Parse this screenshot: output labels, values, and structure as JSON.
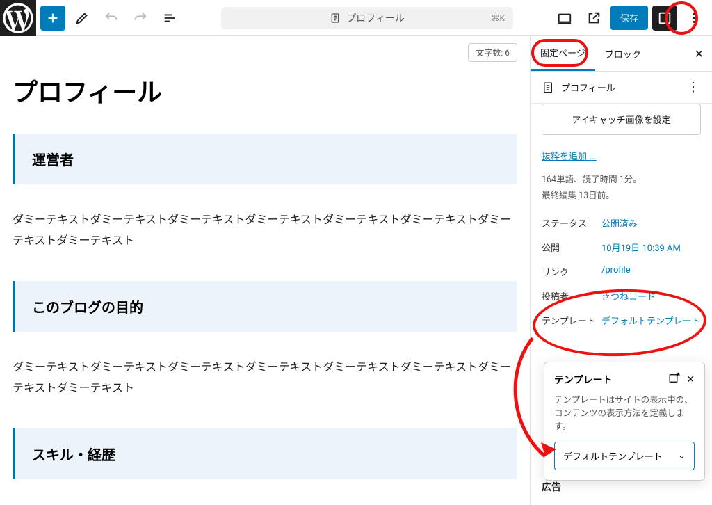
{
  "header": {
    "doc_title": "プロフィール",
    "kbd": "⌘K",
    "save_label": "保存"
  },
  "editor": {
    "wordcount_label": "文字数: 6",
    "title": "プロフィール",
    "h1": "運営者",
    "p1": "ダミーテキストダミーテキストダミーテキストダミーテキストダミーテキストダミーテキストダミーテキストダミーテキスト",
    "h2": "このブログの目的",
    "p2": "ダミーテキストダミーテキストダミーテキストダミーテキストダミーテキストダミーテキストダミーテキストダミーテキスト",
    "h3": "スキル・経歴"
  },
  "sidebar": {
    "tab1": "固定ページ",
    "tab2": "ブロック",
    "page_name": "プロフィール",
    "featured_label": "アイキャッチ画像を設定",
    "excerpt_link": "抜粋を追加 ...",
    "meta1": "164単語、読了時間 1分。",
    "meta2": "最終編集 13日前。",
    "rows": {
      "status_k": "ステータス",
      "status_v": "公開済み",
      "pub_k": "公開",
      "pub_v": "10月19日 10:39 AM",
      "link_k": "リンク",
      "link_v": "/profile",
      "author_k": "投稿者",
      "author_v": "きつねコード",
      "tpl_k": "テンプレート",
      "tpl_v": "デフォルトテンプレート"
    },
    "section_ad": "広告"
  },
  "popover": {
    "title": "テンプレート",
    "desc": "テンプレートはサイトの表示中の、コンテンツの表示方法を定義します。",
    "select_value": "デフォルトテンプレート"
  }
}
